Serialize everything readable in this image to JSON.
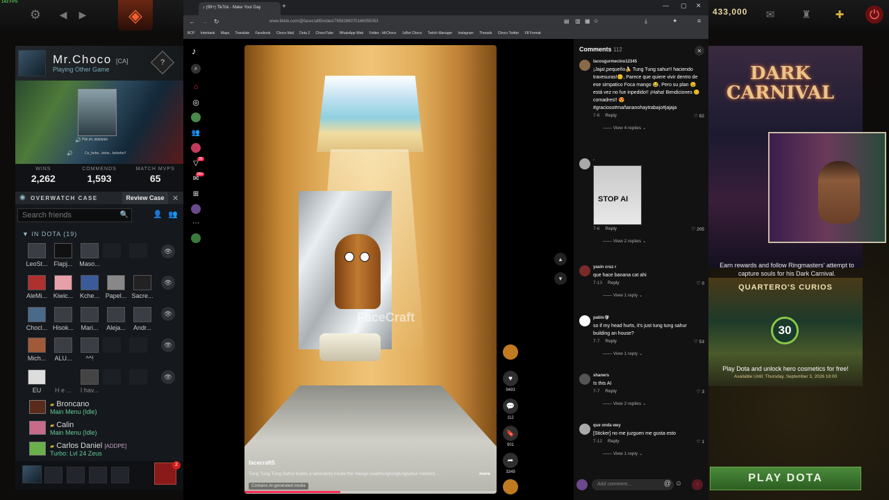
{
  "dota": {
    "fps": "143 FPS",
    "gold": "433,000",
    "profile": {
      "name": "Mr.Choco",
      "tag": "[CA]",
      "status": "Playing Other Game",
      "pip_caption1": "Pipi pii, pipipipipi",
      "pip_caption2": "Ce_hehe...hehe...hehehe!!"
    },
    "stats": [
      {
        "label": "WINS",
        "value": "2,262"
      },
      {
        "label": "COMMENDS",
        "value": "1,593"
      },
      {
        "label": "MATCH MVPS",
        "value": "65"
      }
    ],
    "overwatch": {
      "title": "OVERWATCH CASE",
      "button": "Review Case"
    },
    "search_placeholder": "Search friends",
    "section": "IN DOTA",
    "section_count": "(19)",
    "grid_rows": [
      [
        "LeoSt...",
        "Flapj...",
        "Maso..."
      ],
      [
        "AleMi...",
        "Kiwic...",
        "Kche...",
        "Papel...",
        "Sacre..."
      ],
      [
        "Chocl...",
        "Hisok...",
        "Mari...",
        "Aleja...",
        "Andr..."
      ],
      [
        "Mich...",
        "ALU...",
        "^^!"
      ],
      [
        "EU",
        "H e ...",
        "I hav..."
      ]
    ],
    "friends": [
      {
        "name": "Broncano",
        "status": "Main Menu (Idle)"
      },
      {
        "name": "Calin",
        "status": "Main Menu (Idle)"
      },
      {
        "name": "Carlos Daniel",
        "tag": "[ADDPE]",
        "status": "Turbo: Lvl 24 Zeus"
      }
    ],
    "notif_count": "2",
    "carnival": {
      "title1": "DARK",
      "title2": "CARNIVAL",
      "text": "Earn rewards and follow Ringmasters' attempt to capture souls for his Dark Carnival."
    },
    "curios": {
      "title": "QUARTERO'S CURIOS",
      "badge": "30",
      "promo": "Play Dota and unlock hero cosmetics for free!",
      "avail": "Available Until:  Thursday, September 3, 2026 18:00"
    },
    "play": "PLAY DOTA"
  },
  "browser": {
    "tab_title": "(99+) TikTok - Make Your Day",
    "url": "www.tiktok.com/@facecraft5/video/7659288070166055053",
    "bookmarks": [
      "BCP",
      "Interbank",
      "Maps",
      "Translate",
      "Facebook",
      "Choco Mail",
      "Dota 2",
      "ChocoTube",
      "WhatsApp Web",
      "Folder - MrChoco",
      "1xBet Choco",
      "Twitch Manager",
      "Instagram",
      "Threads",
      "Choco Twitter",
      "F8 Format"
    ],
    "sidebar_badges": {
      "inbox": "99+",
      "activity": "35"
    }
  },
  "video": {
    "watermark": "FaceCraft",
    "author": "facecraft5",
    "description": "Tung Tung Tung Sahur builds a laboratory inside the mango seal#tungtungtungsahur #aistory ...",
    "more": "more",
    "ai_label": "Contains AI-generated media",
    "progress": 0.38,
    "likes": "9493",
    "comments": "112",
    "saves": "901",
    "shares": "3349"
  },
  "comments": {
    "title": "Comments",
    "count": "112",
    "items": [
      {
        "user": "tacosgurmecino12345",
        "text": "¡Jaja!,pequeño🍌 Tung Tung sahur!! haciendo travesuras!😊, Parece que quiere vivir dentro de ese simpatico Foca mango 😂, Pero su plan 😉 está vez no fue inpedido!! ¡Haha! Bendiciones 😊 comadres!! 😍 #gracioso#mañananohaytrabajo#jajaja",
        "date": "7-6",
        "reply": "Reply",
        "likes": "82",
        "view": "View 4 replies"
      },
      {
        "user": "·",
        "sticker": "STOP AI",
        "date": "7-6",
        "reply": "Reply",
        "likes": "205",
        "view": "View 2 replies"
      },
      {
        "user": "yasin cruz r",
        "text": "que hace banana cat ahi",
        "date": "7-13",
        "reply": "Reply",
        "likes": "0",
        "view": "View 1 reply"
      },
      {
        "user": "pablo🛡",
        "text": "so if my head hurts, it's just tung tung sahur building an house?",
        "date": "7-7",
        "reply": "Reply",
        "likes": "53",
        "view": "View 1 reply"
      },
      {
        "user": "shaners",
        "text": "Is this AI",
        "date": "7-7",
        "reply": "Reply",
        "likes": "3",
        "view": "View 2 replies"
      },
      {
        "user": "que onda wey",
        "text": "[Sticker] no me juzguen me gusta esto",
        "date": "7-12",
        "reply": "Reply",
        "likes": "1",
        "view": "View 1 reply"
      }
    ],
    "add_placeholder": "Add comment..."
  }
}
